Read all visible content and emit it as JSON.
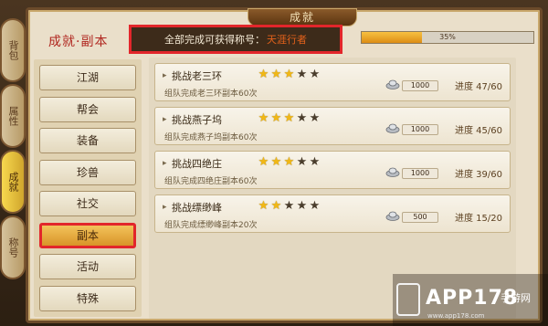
{
  "window": {
    "title": "成就"
  },
  "header": {
    "section_title": "成就·副本",
    "summary_label": "全部完成可获得称号：",
    "summary_title": "天涯行者",
    "progress_percent": 35,
    "progress_text": "35%"
  },
  "side_tabs": [
    {
      "label": "背包",
      "active": false
    },
    {
      "label": "属性",
      "active": false
    },
    {
      "label": "成就",
      "active": true
    },
    {
      "label": "称号",
      "active": false
    }
  ],
  "nav": [
    {
      "label": "江湖",
      "active": false
    },
    {
      "label": "帮会",
      "active": false
    },
    {
      "label": "装备",
      "active": false
    },
    {
      "label": "珍兽",
      "active": false
    },
    {
      "label": "社交",
      "active": false
    },
    {
      "label": "副本",
      "active": true
    },
    {
      "label": "活动",
      "active": false
    },
    {
      "label": "特殊",
      "active": false
    }
  ],
  "achievements": [
    {
      "name": "挑战老三环",
      "desc": "组队完成老三环副本60次",
      "stars": 3,
      "max_stars": 5,
      "reward": "1000",
      "progress": "进度 47/60"
    },
    {
      "name": "挑战燕子坞",
      "desc": "组队完成燕子坞副本60次",
      "stars": 3,
      "max_stars": 5,
      "reward": "1000",
      "progress": "进度 45/60"
    },
    {
      "name": "挑战四绝庄",
      "desc": "组队完成四绝庄副本60次",
      "stars": 3,
      "max_stars": 5,
      "reward": "1000",
      "progress": "进度 39/60"
    },
    {
      "name": "挑战缥缈峰",
      "desc": "组队完成缥缈峰副本20次",
      "stars": 2,
      "max_stars": 5,
      "reward": "500",
      "progress": "进度 15/20"
    }
  ],
  "watermark": {
    "text": "APP178",
    "sub": "手游网",
    "url": "www.app178.com"
  },
  "icons": {
    "row_marker": "arrow-icon",
    "currency": "silver-ingot-icon",
    "star": "star-icon",
    "watermark_logo": "phone-icon"
  },
  "colors": {
    "highlight": "#e2262b",
    "star_on": "#f2b814",
    "star_off": "#4a3d2c",
    "title_orange": "#e3611b"
  }
}
